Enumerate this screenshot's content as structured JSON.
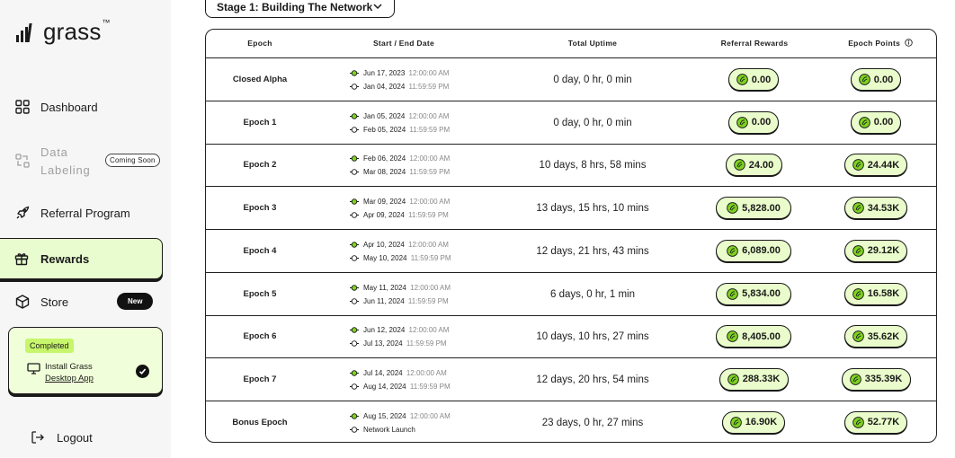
{
  "app": {
    "logo_text": "grass",
    "logo_tm": "™"
  },
  "sidebar": {
    "dashboard": "Dashboard",
    "data_labeling_line1": "Data",
    "data_labeling_line2": "Labeling",
    "coming_soon": "Coming Soon",
    "referral": "Referral Program",
    "rewards": "Rewards",
    "store": "Store",
    "new_badge": "New",
    "task": {
      "status": "Completed",
      "line1": "Install Grass",
      "line2": "Desktop App"
    },
    "logout": "Logout"
  },
  "stage_dropdown": {
    "label": "Stage 1: Building The Network"
  },
  "table": {
    "headers": [
      "Epoch",
      "Start / End Date",
      "Total Uptime",
      "Referral Rewards",
      "Epoch Points"
    ],
    "rows": [
      {
        "epoch": "Closed Alpha",
        "start_date": "Jun 17, 2023",
        "start_time": "12:00:00 AM",
        "end_date": "Jan 04, 2024",
        "end_time": "11:59:59 PM",
        "uptime": "0 day, 0 hr, 0 min",
        "referral": "0.00",
        "points": "0.00"
      },
      {
        "epoch": "Epoch 1",
        "start_date": "Jan 05, 2024",
        "start_time": "12:00:00 AM",
        "end_date": "Feb 05, 2024",
        "end_time": "11:59:59 PM",
        "uptime": "0 day, 0 hr, 0 min",
        "referral": "0.00",
        "points": "0.00"
      },
      {
        "epoch": "Epoch 2",
        "start_date": "Feb 06, 2024",
        "start_time": "12:00:00 AM",
        "end_date": "Mar 08, 2024",
        "end_time": "11:59:59 PM",
        "uptime": "10 days, 8 hrs, 58 mins",
        "referral": "24.00",
        "points": "24.44K"
      },
      {
        "epoch": "Epoch 3",
        "start_date": "Mar 09, 2024",
        "start_time": "12:00:00 AM",
        "end_date": "Apr 09, 2024",
        "end_time": "11:59:59 PM",
        "uptime": "13 days, 15 hrs, 10 mins",
        "referral": "5,828.00",
        "points": "34.53K"
      },
      {
        "epoch": "Epoch 4",
        "start_date": "Apr 10, 2024",
        "start_time": "12:00:00 AM",
        "end_date": "May 10, 2024",
        "end_time": "11:59:59 PM",
        "uptime": "12 days, 21 hrs, 43 mins",
        "referral": "6,089.00",
        "points": "29.12K"
      },
      {
        "epoch": "Epoch 5",
        "start_date": "May 11, 2024",
        "start_time": "12:00:00 AM",
        "end_date": "Jun 11, 2024",
        "end_time": "11:59:59 PM",
        "uptime": "6 days, 0 hr, 1 min",
        "referral": "5,834.00",
        "points": "16.58K"
      },
      {
        "epoch": "Epoch 6",
        "start_date": "Jun 12, 2024",
        "start_time": "12:00:00 AM",
        "end_date": "Jul 13, 2024",
        "end_time": "11:59:59 PM",
        "uptime": "10 days, 10 hrs, 27 mins",
        "referral": "8,405.00",
        "points": "35.62K"
      },
      {
        "epoch": "Epoch 7",
        "start_date": "Jul 14, 2024",
        "start_time": "12:00:00 AM",
        "end_date": "Aug 14, 2024",
        "end_time": "11:59:59 PM",
        "uptime": "12 days, 20 hrs, 54 mins",
        "referral": "288.33K",
        "points": "335.39K"
      },
      {
        "epoch": "Bonus Epoch",
        "start_date": "Aug 15, 2024",
        "start_time": "12:00:00 AM",
        "end_date": "Network Launch",
        "end_time": "",
        "uptime": "23 days, 0 hr, 27 mins",
        "referral": "16.90K",
        "points": "52.77K"
      }
    ]
  },
  "colors": {
    "accent_green": "#c7f56b",
    "pill_bg": "#eafccb",
    "active_nav_bg": "#e8fccf",
    "coin": "#7ed321"
  },
  "icons": [
    "grid-icon",
    "data-label-icon",
    "rocket-icon",
    "gift-icon",
    "box-icon",
    "monitor-icon",
    "check-icon",
    "logout-icon",
    "chevron-down-icon",
    "info-icon",
    "coin-icon",
    "start-dot-icon",
    "end-dot-icon"
  ]
}
